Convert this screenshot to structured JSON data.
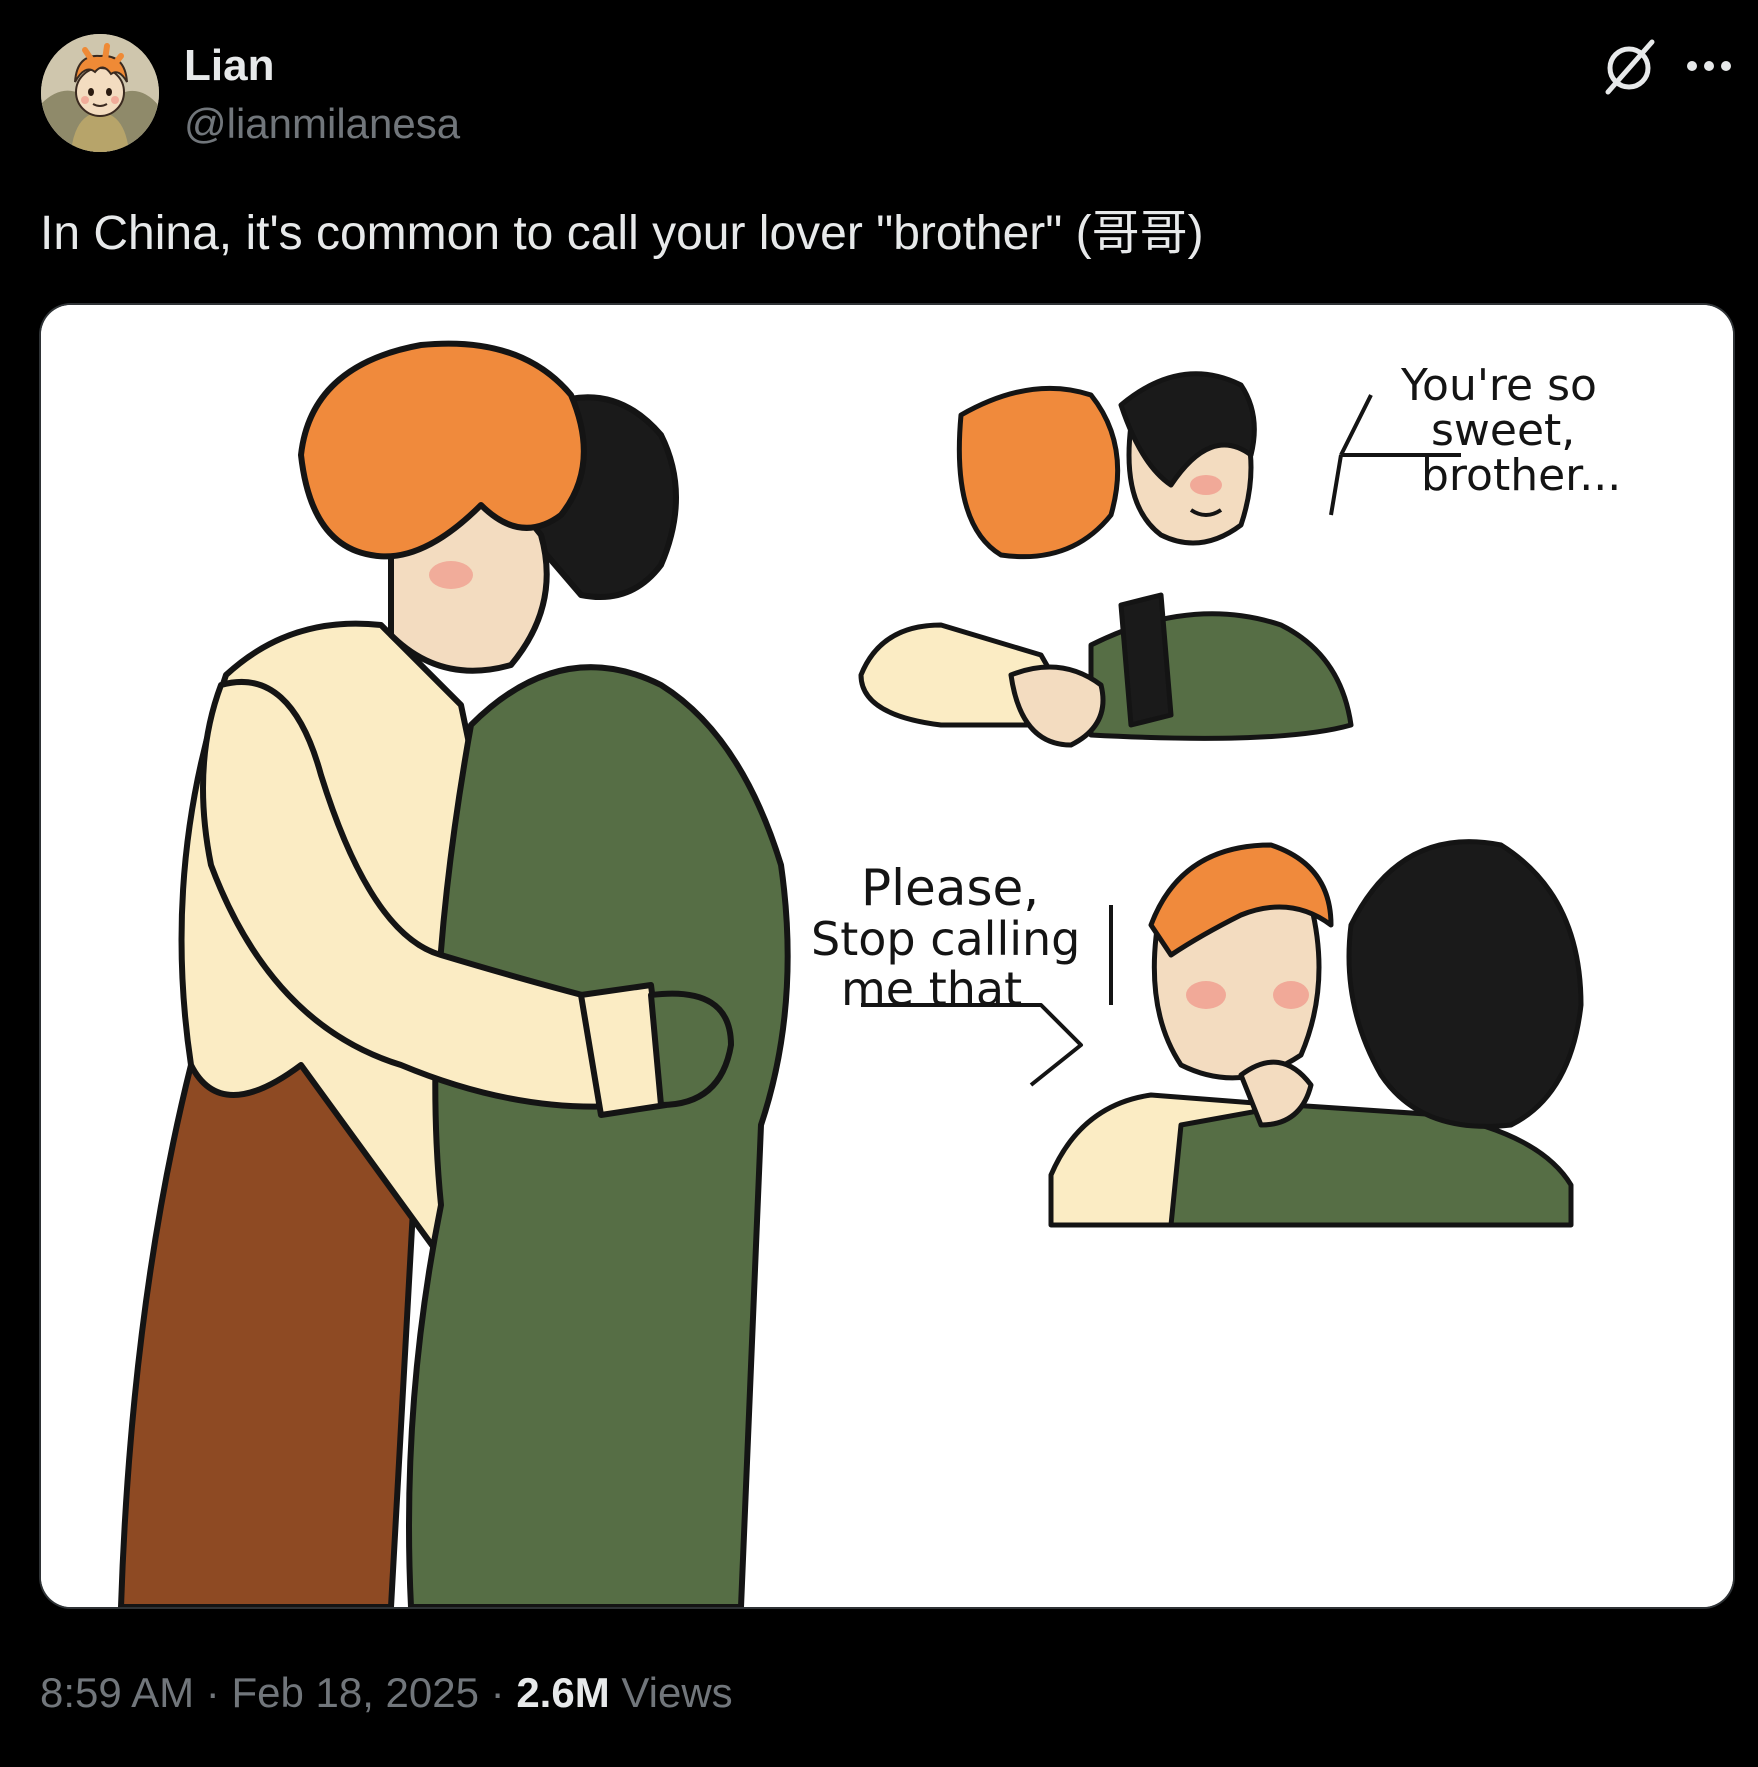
{
  "author": {
    "name": "Lian",
    "handle": "@lianmilanesa"
  },
  "post": {
    "text": "In China, it's common to call your lover \"brother\" (哥哥)",
    "time": "8:59 AM",
    "separator": "·",
    "date": "Feb 18, 2025",
    "views_count": "2.6M",
    "views_label": "Views"
  },
  "icons": {
    "grok": "grok-icon",
    "more": "more-icon"
  },
  "comic": {
    "bubble_top": [
      "You're so",
      "sweet,",
      "brother..."
    ],
    "bubble_bottom": [
      "Please,",
      "Stop calling",
      "me that"
    ]
  },
  "colors": {
    "background": "#000000",
    "text_primary": "#e7e9ea",
    "text_secondary": "#71767b",
    "hair_orange": "#f08a3c",
    "jacket_green": "#566e45",
    "shirt_cream": "#fbecc4",
    "pants_brown": "#8e4a23"
  }
}
